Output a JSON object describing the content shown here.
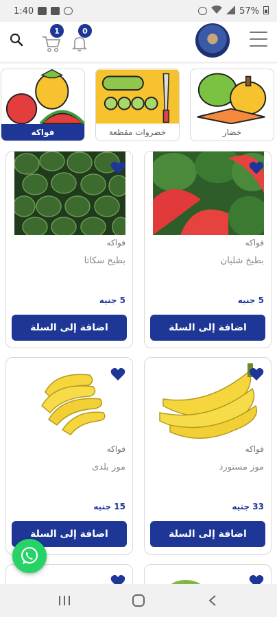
{
  "status_bar": {
    "time": "1:40",
    "battery": "57%"
  },
  "header": {
    "cart_count": "1",
    "notifications_count": "0"
  },
  "categories": [
    {
      "label": "خضار",
      "active": false
    },
    {
      "label": "خضروات مقطعة",
      "active": false
    },
    {
      "label": "فواكه",
      "active": true
    }
  ],
  "products": [
    {
      "category": "فواكه",
      "name": "بطيخ شليان",
      "price": "5 جنيه",
      "button": "اضافة إلى السلة"
    },
    {
      "category": "فواكه",
      "name": "بطيخ سكاتا",
      "price": "5 جنيه",
      "button": "اضافة إلى السلة"
    },
    {
      "category": "فواكه",
      "name": "موز مستورد",
      "price": "33 جنيه",
      "button": "اضافة إلى السلة"
    },
    {
      "category": "فواكه",
      "name": "موز بلدى",
      "price": "15 جنيه",
      "button": "اضافة إلى السلة"
    }
  ],
  "colors": {
    "brand": "#1e3796",
    "whatsapp": "#25d366"
  }
}
